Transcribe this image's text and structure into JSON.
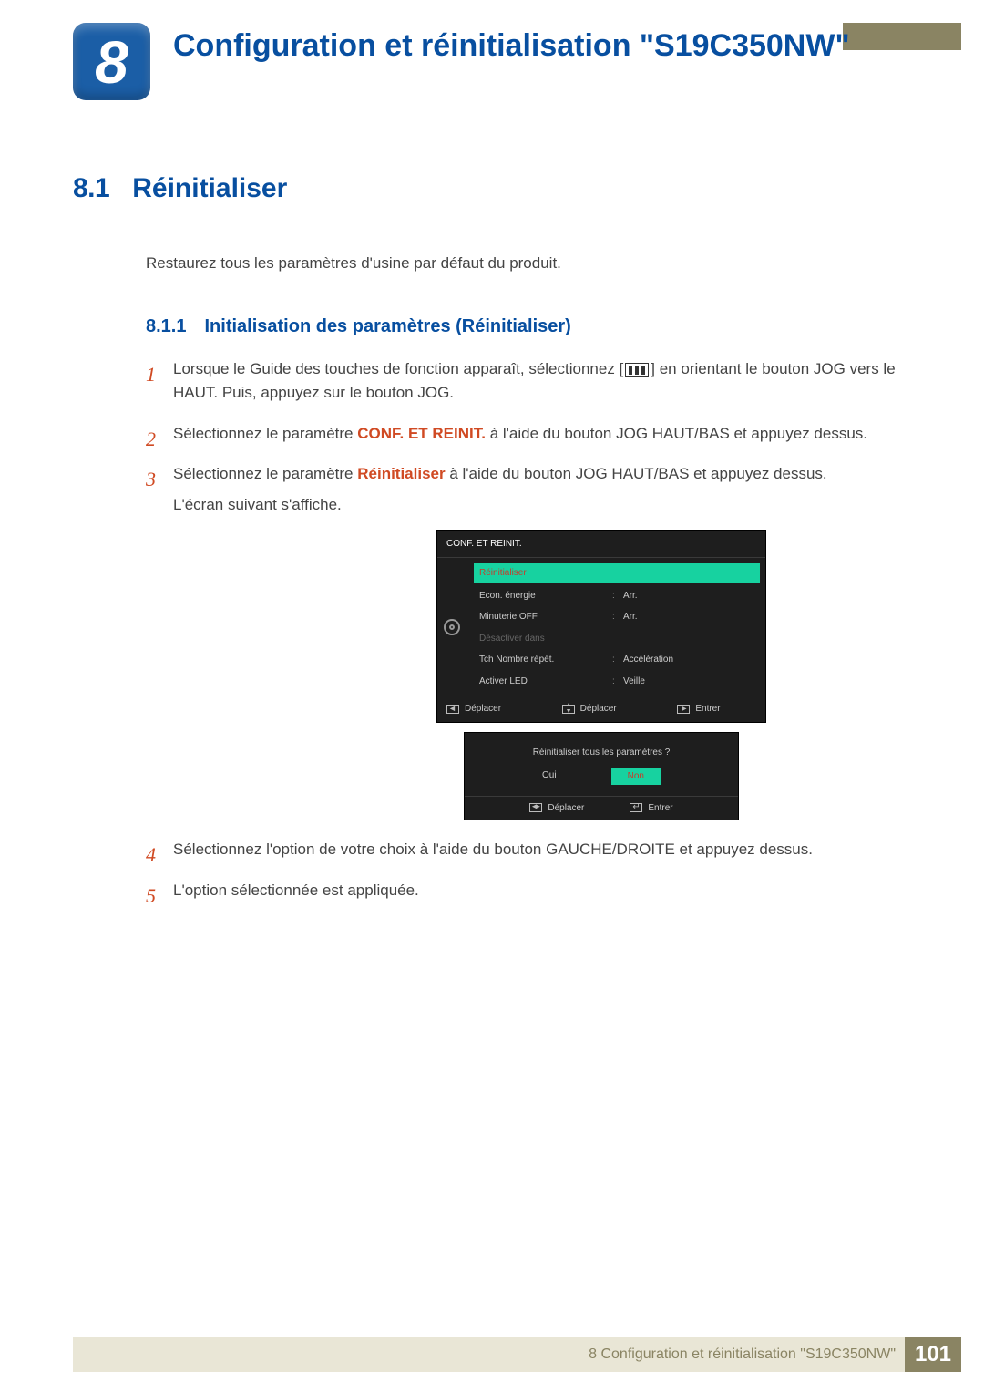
{
  "chapter": {
    "number": "8",
    "title": "Configuration et réinitialisation \"S19C350NW\""
  },
  "section": {
    "number": "8.1",
    "title": "Réinitialiser",
    "intro": "Restaurez tous les paramètres d'usine par défaut du produit."
  },
  "subsection": {
    "number": "8.1.1",
    "title": "Initialisation des paramètres (Réinitialiser)"
  },
  "steps": {
    "s1a": "Lorsque le Guide des touches de fonction apparaît, sélectionnez [",
    "s1b": "] en orientant le bouton JOG vers le HAUT. Puis, appuyez sur le bouton JOG.",
    "s2a": "Sélectionnez le paramètre ",
    "s2hl": "CONF. ET REINIT.",
    "s2b": " à l'aide du bouton JOG HAUT/BAS et appuyez dessus.",
    "s3a": "Sélectionnez le paramètre ",
    "s3hl": "Réinitialiser",
    "s3b": " à l'aide du bouton JOG HAUT/BAS et appuyez dessus.",
    "s3c": "L'écran suivant s'affiche.",
    "s4": "Sélectionnez l'option de votre choix à l'aide du bouton GAUCHE/DROITE et appuyez dessus.",
    "s5": "L'option sélectionnée est appliquée."
  },
  "osd": {
    "title": "CONF. ET REINIT.",
    "rows": [
      {
        "label": "Réinitialiser",
        "val": "",
        "state": "selected"
      },
      {
        "label": "Econ. énergie",
        "val": "Arr.",
        "state": ""
      },
      {
        "label": "Minuterie OFF",
        "val": "Arr.",
        "state": ""
      },
      {
        "label": "Désactiver dans",
        "val": "",
        "state": "disabled"
      },
      {
        "label": "Tch Nombre répét.",
        "val": "Accélération",
        "state": ""
      },
      {
        "label": "Activer LED",
        "val": "Veille",
        "state": ""
      }
    ],
    "foot": {
      "move": "Déplacer",
      "enter": "Entrer"
    }
  },
  "confirm": {
    "question": "Réinitialiser tous les paramètres ?",
    "yes": "Oui",
    "no": "Non",
    "move": "Déplacer",
    "enter": "Entrer"
  },
  "footer": {
    "text": "8 Configuration et réinitialisation \"S19C350NW\"",
    "page": "101"
  }
}
